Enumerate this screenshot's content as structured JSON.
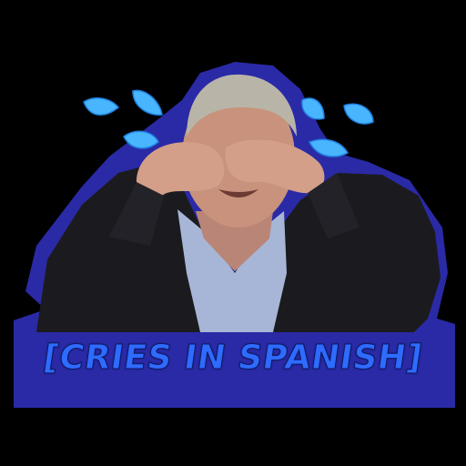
{
  "sticker": {
    "caption": "[CRIES IN SPANISH]",
    "colors": {
      "background": "#000000",
      "outline": "#2a2aa6",
      "caption": "#2e6bff",
      "tear_drops": "#49b5ff",
      "suit": "#1b1b1f",
      "shirt": "#a7b6d6",
      "skin": "#c8927c",
      "hair": "#b9b4a8"
    },
    "icons": [
      "tear-drop-icon"
    ]
  }
}
